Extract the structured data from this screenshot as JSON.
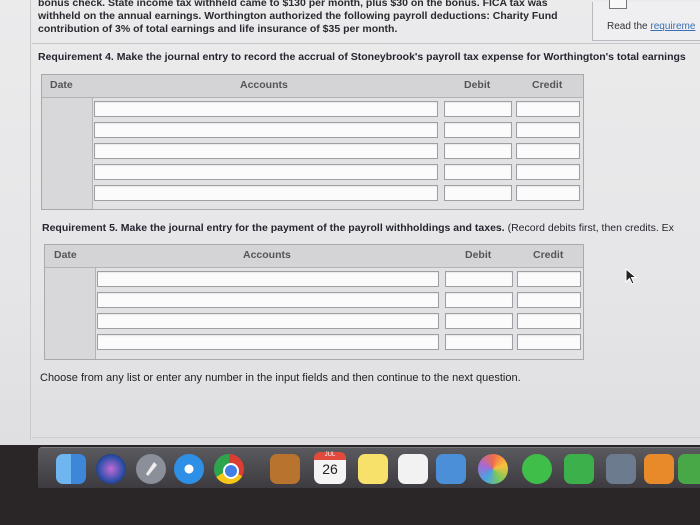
{
  "problem": {
    "line1": "bonus check. State income tax withheld came to $130 per month, plus $30 on the bonus. FICA tax was",
    "line2": "withheld on the annual earnings. Worthington authorized the following payroll deductions: Charity Fund",
    "line3": "contribution of 3% of total earnings and life insurance of $35 per month."
  },
  "read_requirements": {
    "prefix": "Read the ",
    "link": "requireme"
  },
  "requirement4": {
    "title": "Requirement 4. Make the journal entry to record the accrual of Stoneybrook's payroll tax expense for Worthington's total earnings",
    "columns": {
      "date": "Date",
      "accounts": "Accounts",
      "debit": "Debit",
      "credit": "Credit"
    }
  },
  "requirement5": {
    "title": "Requirement 5. Make the journal entry for the payment of the payroll withholdings and taxes.",
    "note": "(Record debits first, then credits. Ex",
    "columns": {
      "date": "Date",
      "accounts": "Accounts",
      "debit": "Debit",
      "credit": "Credit"
    }
  },
  "instruction": "Choose from any list or enter any number in the input fields and then continue to the next question.",
  "dock": {
    "calendar_month": "JUL",
    "calendar_day": "26",
    "icons": [
      "finder-icon",
      "siri-icon",
      "launchpad-icon",
      "safari-icon",
      "chrome-icon",
      "notes-folder-icon",
      "calendar-icon",
      "stickies-icon",
      "reminders-icon",
      "photo-booth-icon",
      "photos-icon",
      "messages-icon",
      "facetime-icon",
      "preview-icon",
      "books-icon",
      "numbers-icon"
    ]
  },
  "colors": {
    "screen_bg": "#e8e8ea",
    "link": "#3b6fb5",
    "bezel": "#2a2527"
  }
}
